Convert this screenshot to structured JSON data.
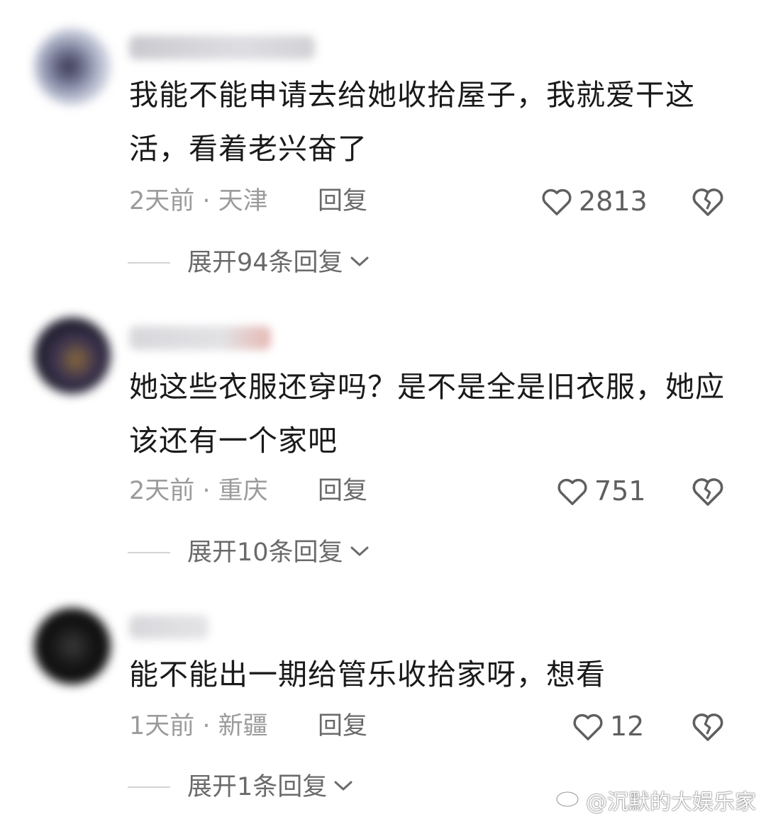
{
  "comments": [
    {
      "text": "我能不能申请去给她收拾屋子，我就爱干这活，看着老兴奋了",
      "time": "2天前",
      "location": "天津",
      "reply_label": "回复",
      "likes": "2813",
      "expand_label": "展开94条回复"
    },
    {
      "text": "她这些衣服还穿吗？是不是全是旧衣服，她应该还有一个家吧",
      "time": "2天前",
      "location": "重庆",
      "reply_label": "回复",
      "likes": "751",
      "expand_label": "展开10条回复"
    },
    {
      "text": "能不能出一期给管乐收拾家呀，想看",
      "time": "1天前",
      "location": "新疆",
      "reply_label": "回复",
      "likes": "12",
      "expand_label": "展开1条回复"
    }
  ],
  "meta_separator": " · ",
  "watermark": "@沉默的大娱乐家",
  "icons": {
    "like": "heart-outline-icon",
    "dislike": "broken-heart-icon",
    "expand": "chevron-down-icon",
    "watermark": "weibo-logo-icon"
  },
  "colors": {
    "text": "#1a1a1a",
    "meta": "#9b9b9b",
    "secondary": "#6a6a6a",
    "icon": "#5f5f5f"
  }
}
